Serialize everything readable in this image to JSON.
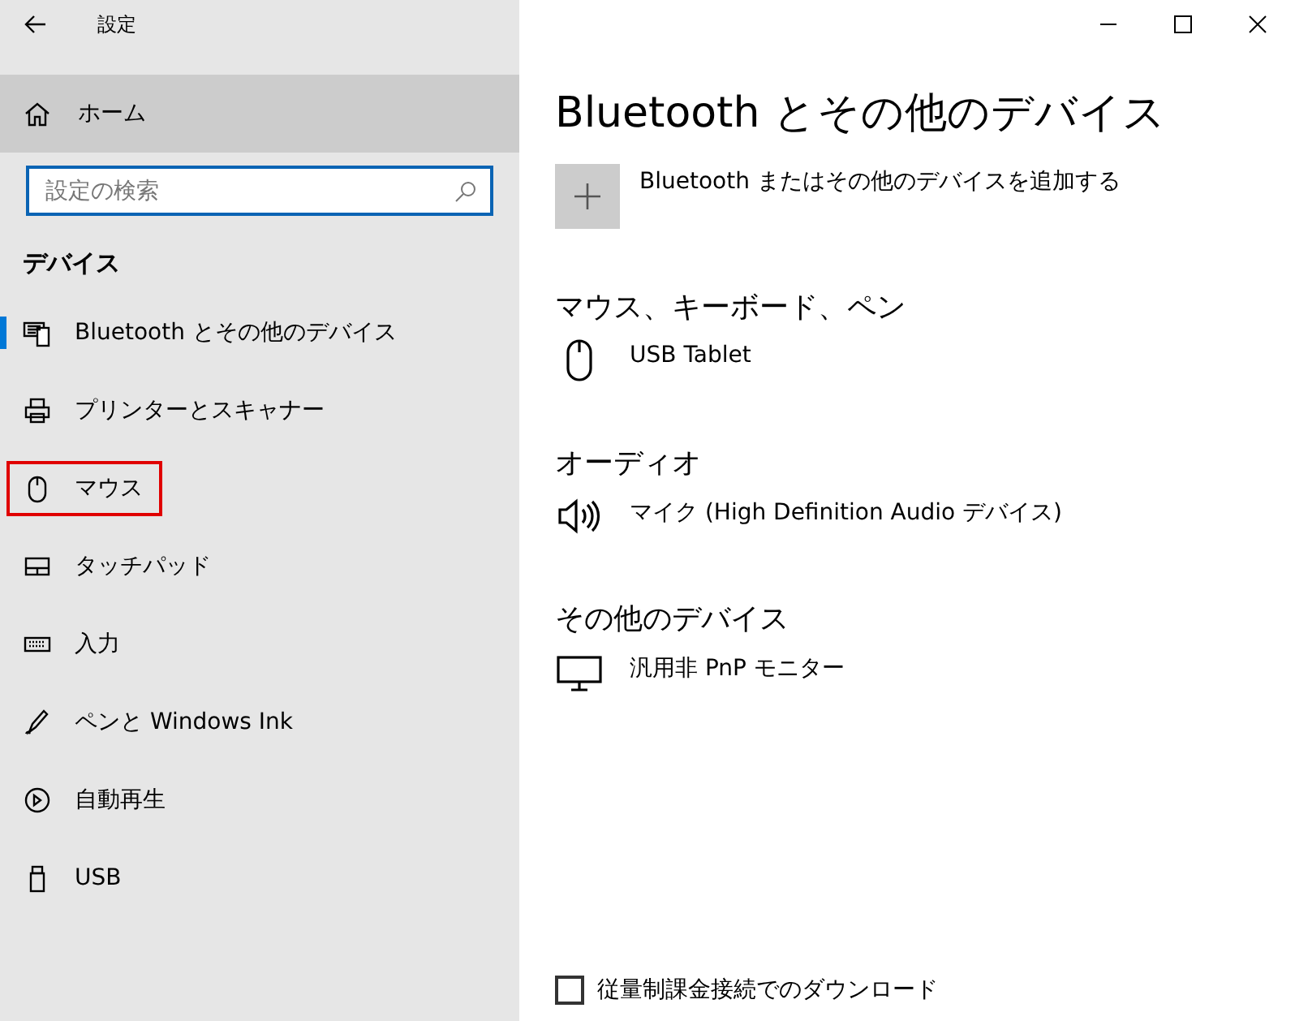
{
  "window": {
    "title": "設定"
  },
  "sidebar": {
    "home": {
      "label": "ホーム",
      "highlighted": true
    },
    "search": {
      "placeholder": "設定の検索"
    },
    "section": "デバイス",
    "items": [
      {
        "label": "Bluetooth とその他のデバイス",
        "kind": "bluetooth",
        "selected": true,
        "outlined": false
      },
      {
        "label": "プリンターとスキャナー",
        "kind": "printer",
        "selected": false,
        "outlined": false
      },
      {
        "label": "マウス",
        "kind": "mouse",
        "selected": false,
        "outlined": true
      },
      {
        "label": "タッチパッド",
        "kind": "touchpad",
        "selected": false,
        "outlined": false
      },
      {
        "label": "入力",
        "kind": "keyboard",
        "selected": false,
        "outlined": false
      },
      {
        "label": "ペンと Windows Ink",
        "kind": "pen",
        "selected": false,
        "outlined": false
      },
      {
        "label": "自動再生",
        "kind": "autoplay",
        "selected": false,
        "outlined": false
      },
      {
        "label": "USB",
        "kind": "usb",
        "selected": false,
        "outlined": false
      }
    ]
  },
  "main": {
    "title": "Bluetooth とその他のデバイス",
    "add_device": {
      "label": "Bluetooth またはその他のデバイスを追加する"
    },
    "groups": [
      {
        "heading": "マウス、キーボード、ペン",
        "devices": [
          {
            "name": "USB Tablet",
            "kind": "mouse"
          }
        ]
      },
      {
        "heading": "オーディオ",
        "devices": [
          {
            "name": "マイク (High Definition Audio デバイス)",
            "kind": "speaker"
          }
        ]
      },
      {
        "heading": "その他のデバイス",
        "devices": [
          {
            "name": "汎用非 PnP モニター",
            "kind": "monitor"
          }
        ]
      }
    ],
    "metered_download": {
      "label": "従量制課金接続でのダウンロード",
      "checked": false
    }
  }
}
